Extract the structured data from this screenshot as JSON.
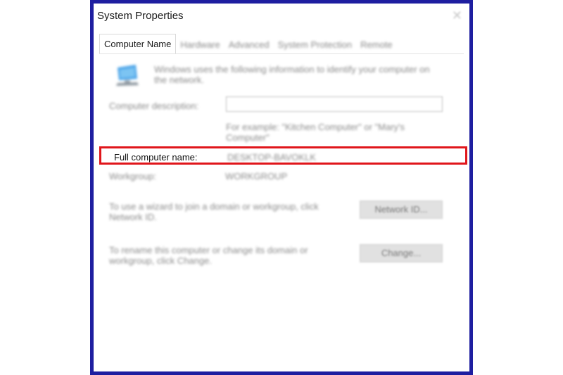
{
  "window": {
    "title": "System Properties",
    "close_glyph": "✕"
  },
  "tabs": [
    {
      "label": "Computer Name",
      "active": true
    },
    {
      "label": "Hardware",
      "active": false
    },
    {
      "label": "Advanced",
      "active": false
    },
    {
      "label": "System Protection",
      "active": false
    },
    {
      "label": "Remote",
      "active": false
    }
  ],
  "panel": {
    "intro": "Windows uses the following information to identify your computer on the network.",
    "description_label": "Computer description:",
    "description_value": "",
    "example": "For example: \"Kitchen Computer\" or \"Mary's Computer\"",
    "full_name_label": "Full computer name:",
    "full_name_value": "DESKTOP-BAVOKLK",
    "workgroup_label": "Workgroup:",
    "workgroup_value": "WORKGROUP",
    "network_id_text": "To use a wizard to join a domain or workgroup, click Network ID.",
    "network_id_button": "Network ID...",
    "change_text": "To rename this computer or change its domain or workgroup, click Change.",
    "change_button": "Change..."
  },
  "colors": {
    "frame_border": "#1e1ea0",
    "highlight": "#e0161b",
    "icon_blue": "#4aa3e8"
  },
  "icons": {
    "computer": "computer-monitor-icon",
    "close": "close-icon"
  }
}
